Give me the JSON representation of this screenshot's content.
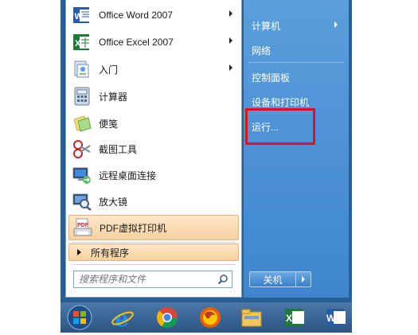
{
  "left_items": [
    {
      "label": "Office Word 2007",
      "icon": "word-icon",
      "submenu": true
    },
    {
      "label": "Office Excel 2007",
      "icon": "excel-icon",
      "submenu": true
    },
    {
      "label": "入门",
      "icon": "getting-started-icon",
      "submenu": true
    },
    {
      "label": "计算器",
      "icon": "calculator-icon",
      "submenu": false
    },
    {
      "label": "便笺",
      "icon": "sticky-notes-icon",
      "submenu": false
    },
    {
      "label": "截图工具",
      "icon": "snipping-tool-icon",
      "submenu": false
    },
    {
      "label": "远程桌面连接",
      "icon": "remote-desktop-icon",
      "submenu": false
    },
    {
      "label": "放大镜",
      "icon": "magnifier-icon",
      "submenu": false
    },
    {
      "label": "PDF虚拟打印机",
      "icon": "pdf-printer-icon",
      "submenu": false
    }
  ],
  "all_programs": "所有程序",
  "search": {
    "placeholder": "搜索程序和文件"
  },
  "right_items": [
    {
      "label": "计算机",
      "submenu": true
    },
    {
      "label": "网络",
      "submenu": false
    },
    {
      "label": "控制面板",
      "submenu": false
    },
    {
      "label": "设备和打印机",
      "submenu": false
    },
    {
      "label": "运行...",
      "submenu": false
    }
  ],
  "shutdown": {
    "label": "关机"
  },
  "taskbar": [
    "start-orb-icon",
    "internet-explorer-icon",
    "chrome-icon",
    "firefox-icon",
    "file-explorer-icon",
    "excel-icon",
    "word-icon"
  ],
  "colors": {
    "highlight_box": "#d8141d",
    "right_pane": "#4a8ed4",
    "hover_item": "#f8d1a1"
  }
}
